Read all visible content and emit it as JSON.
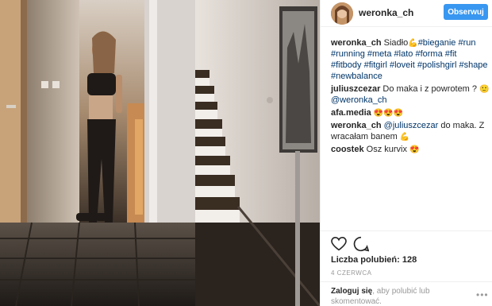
{
  "header": {
    "username": "weronka_ch",
    "follow_label": "Obserwuj"
  },
  "caption": {
    "username": "weronka_ch",
    "text": "Siadło",
    "emoji": "💪",
    "hashtags": [
      "#bieganie",
      "#run",
      "#running",
      "#meta",
      "#lato",
      "#forma",
      "#fit",
      "#fitbody",
      "#fitgirl",
      "#loveit",
      "#polishgirl",
      "#shape",
      "#newbalance"
    ]
  },
  "comments": [
    {
      "username": "juliuszcezar",
      "text": "Do maka i z powrotem ?",
      "emoji": "🙂",
      "mention": "@weronka_ch"
    },
    {
      "username": "afa.media",
      "text": "",
      "emoji": "😍😍😍"
    },
    {
      "username": "weronka_ch",
      "mention": "@juliuszcezar",
      "text": "do maka. Z wracałam banem",
      "emoji": "💪"
    },
    {
      "username": "coostek",
      "text": "Osz kurvix",
      "emoji": "😍"
    }
  ],
  "stats": {
    "likes_label": "Liczba polubień: 128",
    "date": "4 CZERWCA"
  },
  "login": {
    "link": "Zaloguj się",
    "rest": ", aby polubić lub skomentować."
  },
  "icons": {
    "like": "heart-icon",
    "comment": "comment-bubble-icon",
    "more": "more-options-icon"
  },
  "colors": {
    "follow_button": "#3897f0",
    "hashtag": "#003569",
    "border": "#efefef"
  }
}
